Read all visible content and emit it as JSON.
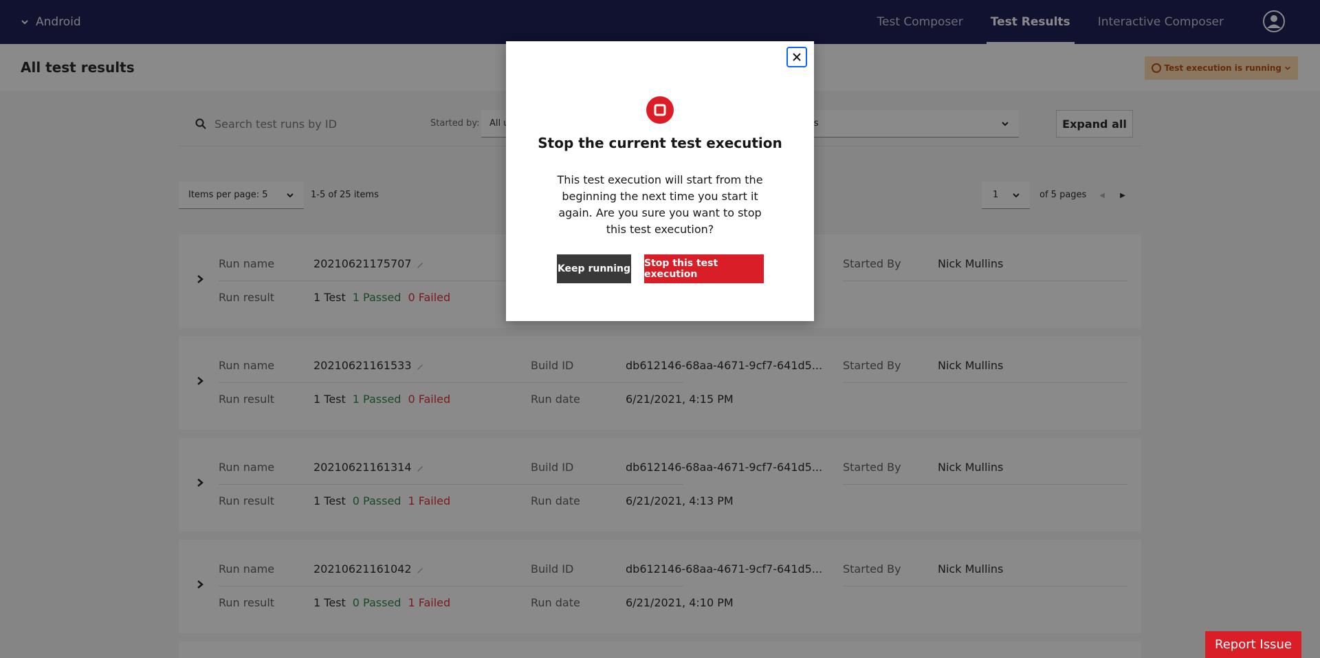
{
  "nav": {
    "project": "Android",
    "links": [
      "Test Composer",
      "Test Results",
      "Interactive Composer"
    ],
    "active_index": 1,
    "user_icon": "user-avatar-icon"
  },
  "header": {
    "title": "All test results",
    "status": "Test execution is running"
  },
  "filters": {
    "search_placeholder": "Search test runs by ID",
    "started_by_label": "Started by:",
    "started_by_value": "All u",
    "builds_value": "uilds",
    "expand_all": "Expand all"
  },
  "pagination": {
    "items_per_page": "Items per page: 5",
    "range": "1-5 of 25 items",
    "page": "1",
    "of_pages": "of 5 pages"
  },
  "labels": {
    "run_name": "Run name",
    "run_result": "Run result",
    "build_id": "Build ID",
    "run_date": "Run date",
    "started_by": "Started By"
  },
  "runs": [
    {
      "name": "20210621175707",
      "tests": "1 Test",
      "passed": "1 Passed",
      "failed": "0 Failed",
      "build_id": "",
      "run_date": "",
      "started_by": "Nick Mullins"
    },
    {
      "name": "20210621161533",
      "tests": "1 Test",
      "passed": "1 Passed",
      "failed": "0 Failed",
      "build_id": "db612146-68aa-4671-9cf7-641d5...",
      "run_date": "6/21/2021, 4:15 PM",
      "started_by": "Nick Mullins"
    },
    {
      "name": "20210621161314",
      "tests": "1 Test",
      "passed": "0 Passed",
      "failed": "1 Failed",
      "build_id": "db612146-68aa-4671-9cf7-641d5...",
      "run_date": "6/21/2021, 4:13 PM",
      "started_by": "Nick Mullins"
    },
    {
      "name": "20210621161042",
      "tests": "1 Test",
      "passed": "0 Passed",
      "failed": "1 Failed",
      "build_id": "db612146-68aa-4671-9cf7-641d5...",
      "run_date": "6/21/2021, 4:10 PM",
      "started_by": "Nick Mullins"
    }
  ],
  "modal": {
    "title": "Stop the current test execution",
    "body": "This test execution will start from the beginning the next time you start it again. Are you sure you want to stop this test execution?",
    "keep_label": "Keep running",
    "stop_label": "Stop this test execution"
  },
  "report_issue": "Report Issue",
  "colors": {
    "nav_bg": "#0d0d4a",
    "danger": "#da1e28",
    "success": "#198038",
    "warning_bg": "#fcd9a8",
    "focus": "#0f62fe"
  }
}
